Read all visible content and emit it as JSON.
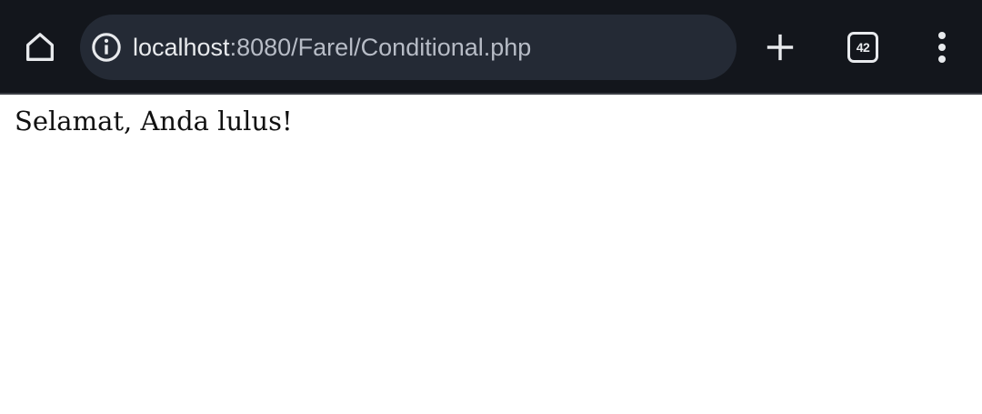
{
  "browser": {
    "url_host": "localhost",
    "url_path": ":8080/Farel/Conditional.php",
    "tab_count": "42",
    "icons": {
      "home": "home-icon",
      "info": "info-icon",
      "new_tab": "plus-icon",
      "tabs": "tab-switcher-icon",
      "menu": "more-vert-icon"
    },
    "colors": {
      "toolbar_bg": "#13161c",
      "omnibox_bg": "#242a35",
      "icon": "#e8eaed"
    }
  },
  "page": {
    "message": "Selamat, Anda lulus!"
  }
}
